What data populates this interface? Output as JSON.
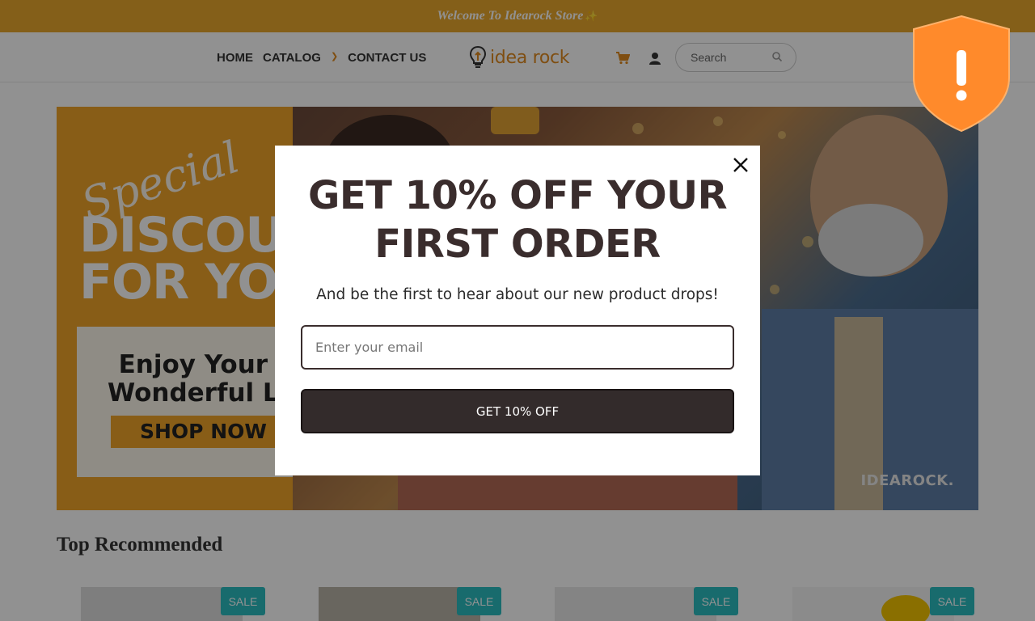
{
  "announcement": {
    "text": "Welcome To Idearock Store",
    "sparkle": "✨"
  },
  "header": {
    "nav": [
      {
        "label": "HOME"
      },
      {
        "label": "CATALOG",
        "has_dropdown": true
      },
      {
        "label": "CONTACT US"
      }
    ],
    "logo_text": "idea rock",
    "cart_icon": "cart-icon",
    "account_icon": "user-icon",
    "search": {
      "placeholder": "Search"
    }
  },
  "banner": {
    "script_text": "Special",
    "headline": "DISCOUN\nFOR YOU",
    "card_text": "Enjoy Your\nWonderful L",
    "cta": "SHOP NOW →",
    "brand_mark": "IDEAROCK."
  },
  "section": {
    "title": "Top Recommended",
    "products": [
      {
        "badge": "SALE"
      },
      {
        "badge": "SALE"
      },
      {
        "badge": "SALE"
      },
      {
        "badge": "SALE"
      }
    ]
  },
  "popup": {
    "title_line1": "GET 10% OFF YOUR",
    "title_line2": "FIRST ORDER",
    "subtitle": "And be the first to hear about our new product drops!",
    "email_placeholder": "Enter your email",
    "submit_label": "GET 10% OFF"
  },
  "colors": {
    "accent": "#e9a72d",
    "sale_badge": "#2bbcc0",
    "popup_button": "#332b2b",
    "shield": "#ff8a2b"
  }
}
